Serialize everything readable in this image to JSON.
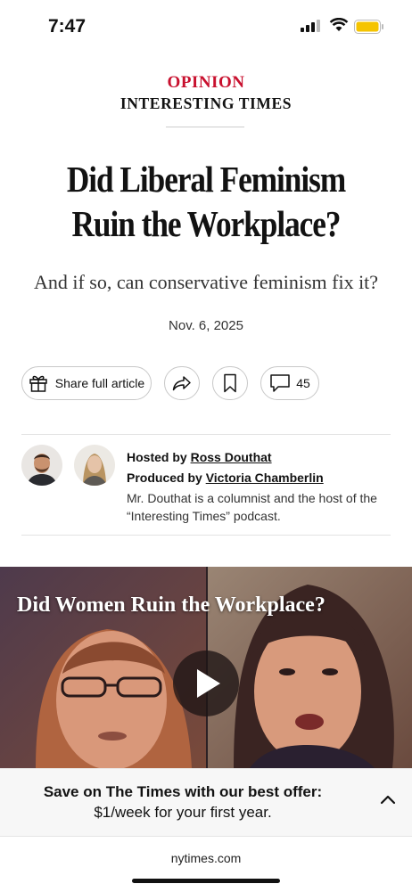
{
  "status_bar": {
    "time": "7:47"
  },
  "article": {
    "kicker": "OPINION",
    "series": "INTERESTING TIMES",
    "headline_line1": "Did Liberal Feminism",
    "headline_line2": "Ruin the Workplace?",
    "dek": "And if so, can conservative feminism fix it?",
    "date": "Nov. 6, 2025"
  },
  "actions": {
    "share_full_label": "Share full article",
    "comment_count": "45"
  },
  "credits": {
    "hosted_label": "Hosted by",
    "host_name": "Ross Douthat",
    "produced_label": "Produced by",
    "producer_name": "Victoria Chamberlin",
    "note": "Mr. Douthat is a columnist and the host of the “Interesting Times” podcast."
  },
  "video": {
    "title": "Did Women Ruin the Workplace?"
  },
  "offer": {
    "line1": "Save on The Times with our best offer:",
    "line2": "$1/week for your first year."
  },
  "browser": {
    "domain": "nytimes.com"
  },
  "colors": {
    "kicker_red": "#c8102e",
    "battery_yellow": "#f5c400"
  },
  "icons": [
    "signal-icon",
    "wifi-icon",
    "battery-icon",
    "gift-icon",
    "share-icon",
    "bookmark-icon",
    "comment-icon",
    "play-icon",
    "chevron-up-icon"
  ]
}
